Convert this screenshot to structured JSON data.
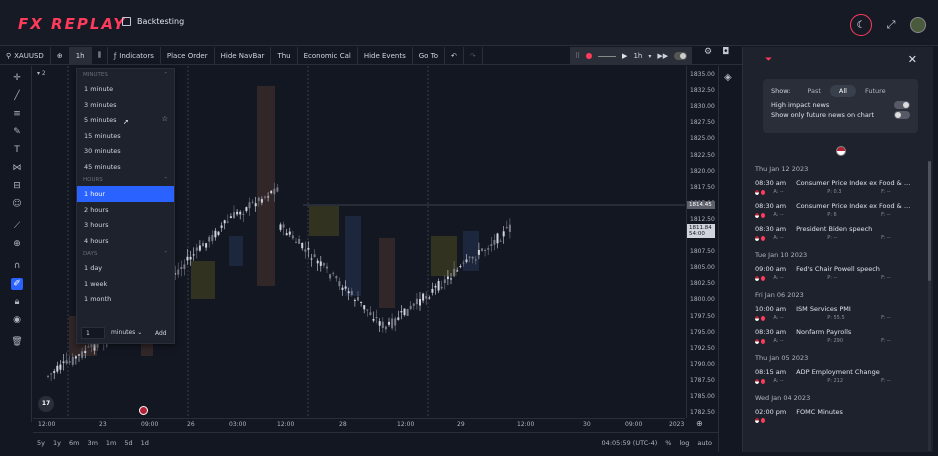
{
  "header": {
    "logo": "FX REPLAY",
    "mode_label": "Backtesting"
  },
  "toolbar": {
    "symbol": "XAUUSD",
    "interval": "1h",
    "items": [
      "Indicators",
      "Place Order",
      "Hide NavBar",
      "Thu",
      "Economic Cal",
      "Hide Events",
      "Go To"
    ],
    "undo": "↶",
    "redo": "↷",
    "replay_interval": "1h"
  },
  "dropdown": {
    "sections": [
      {
        "label": "MINUTES",
        "items": [
          "1 minute",
          "3 minutes",
          "5 minutes",
          "15 minutes",
          "30 minutes",
          "45 minutes"
        ]
      },
      {
        "label": "HOURS",
        "items": [
          "1 hour",
          "2 hours",
          "3 hours",
          "4 hours"
        ]
      },
      {
        "label": "DAYS",
        "items": [
          "1 day",
          "1 week",
          "1 month"
        ]
      }
    ],
    "selected": "1 hour",
    "custom_value": "1",
    "custom_unit": "minutes",
    "add_label": "Add"
  },
  "chart": {
    "price_labels": [
      "1835.00",
      "1832.50",
      "1830.00",
      "1827.50",
      "1825.00",
      "1822.50",
      "1820.00",
      "1817.50",
      "1815.00",
      "1812.50",
      "1810.00",
      "1807.50",
      "1805.00",
      "1802.50",
      "1800.00",
      "1797.50",
      "1795.00",
      "1792.50",
      "1790.00",
      "1787.50",
      "1785.00",
      "1782.50"
    ],
    "price_tag_1": "1814.45",
    "price_tag_2": "1811.84",
    "price_tag_2_sub": "54:00",
    "time_labels": [
      "12:00",
      "23",
      "09:00",
      "26",
      "03:00",
      "12:00",
      "28",
      "12:00",
      "29",
      "12:00",
      "30",
      "09:00",
      "2023"
    ],
    "legend_count": "2",
    "tv_logo": "17"
  },
  "bottom": {
    "ranges": [
      "5y",
      "1y",
      "6m",
      "3m",
      "1m",
      "5d",
      "1d"
    ],
    "clock": "04:05:59 (UTC-4)",
    "percent": "%",
    "log": "log",
    "auto": "auto"
  },
  "news_panel": {
    "show_label": "Show:",
    "tabs": [
      "Past",
      "All",
      "Future"
    ],
    "active_tab": "All",
    "opt1": "High impact news",
    "opt2": "Show only future news on chart",
    "groups": [
      {
        "date": "Thu Jan 12 2023",
        "items": [
          {
            "time": "08:30 am",
            "title": "Consumer Price Index ex Food & Energy (...",
            "a": "A: --",
            "p": "P: 0.3",
            "f": "F: --"
          },
          {
            "time": "08:30 am",
            "title": "Consumer Price Index ex Food & Energy (...",
            "a": "A: --",
            "p": "P: 6",
            "f": "F: --"
          },
          {
            "time": "08:30 am",
            "title": "President Biden speech",
            "a": "A: --",
            "p": "P: --",
            "f": "F: --"
          }
        ]
      },
      {
        "date": "Tue Jan 10 2023",
        "items": [
          {
            "time": "09:00 am",
            "title": "Fed's Chair Powell speech",
            "a": "A: --",
            "p": "P: --",
            "f": "F: --"
          }
        ]
      },
      {
        "date": "Fri Jan 06 2023",
        "items": [
          {
            "time": "10:00 am",
            "title": "ISM Services PMI",
            "a": "A: --",
            "p": "P: 55.5",
            "f": "F: --"
          },
          {
            "time": "08:30 am",
            "title": "Nonfarm Payrolls",
            "a": "A: --",
            "p": "P: 290",
            "f": "F: --"
          }
        ]
      },
      {
        "date": "Thu Jan 05 2023",
        "items": [
          {
            "time": "08:15 am",
            "title": "ADP Employment Change",
            "a": "A: --",
            "p": "P: 212",
            "f": "F: --"
          }
        ]
      },
      {
        "date": "Wed Jan 04 2023",
        "items": [
          {
            "time": "02:00 pm",
            "title": "FOMC Minutes",
            "a": "",
            "p": "",
            "f": ""
          }
        ]
      }
    ]
  }
}
